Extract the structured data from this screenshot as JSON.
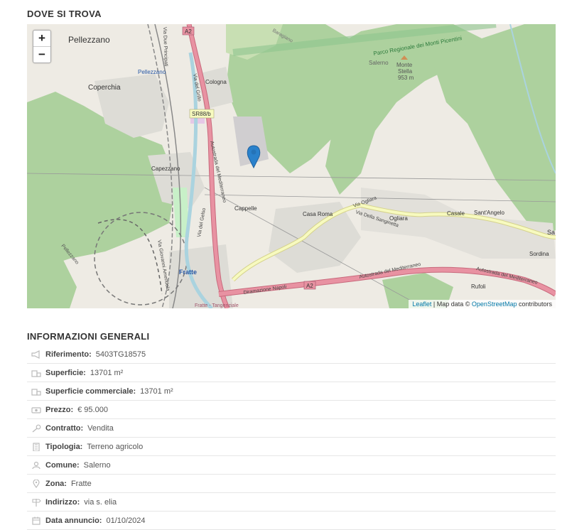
{
  "location_section": {
    "title": "DOVE SI TROVA"
  },
  "map": {
    "zoom_in_label": "+",
    "zoom_out_label": "−",
    "attribution": {
      "leaflet": "Leaflet",
      "mapdata": " | Map data © ",
      "osm": "OpenStreetMap",
      "contributors": " contributors"
    },
    "labels": {
      "pellezzano": "Pellezzano",
      "pellezzano_blue": "Pellezzano",
      "coperchia": "Coperchia",
      "cologna": "Cologna",
      "capezzano": "Capezzano",
      "cappelle": "Cappelle",
      "casa_roma": "Casa Roma",
      "ogliara": "Ogliara",
      "casale": "Casale",
      "santangelo": "Sant'Angelo",
      "sordina": "Sordina",
      "rufoli": "Rufoli",
      "fratte": "Fratte",
      "monte": "Monte",
      "stella": "Stella",
      "elev": "953 m",
      "salerno_top": "Salerno",
      "parco": "Parco Regionale dei Monti Picentini",
      "a2_top": "A2",
      "a2_bottom": "A2",
      "sr88b": "SR88/b",
      "autostrada_1": "Autostrada del Mediterraneo",
      "autostrada_2": "Autostrada del Mediterraneo",
      "autostrada_3": "Autostrada del Mediterraneo",
      "diramazione": "Diramazione Napoli",
      "via_ogliara": "Via Ogliara",
      "via_sanginetta": "Via Della Sanginetta",
      "via_grillo": "Via del Grillo",
      "via_gelso": "Via del Gelso",
      "via_principati": "Via Due Principati",
      "via_amendola": "Via Giovanni Amendola",
      "fratte_tangenziale": "Fratte - Tangenziale",
      "sa_edge": "Sa",
      "pellezzano_rot": "Pellezzano",
      "baragiano": "Baragiano"
    },
    "colors": {
      "land": "#eeebe4",
      "forest": "#add19e",
      "motorway": "#e892a2",
      "trunk": "#f9b29c",
      "secondary": "#f7fabf",
      "pin": "#2a81cb"
    }
  },
  "general_section": {
    "title": "INFORMAZIONI GENERALI",
    "rows": [
      {
        "icon": "megaphone-icon",
        "label": "Riferimento:",
        "value": "5403TG18575"
      },
      {
        "icon": "area-icon",
        "label": "Superficie:",
        "value": "13701 m²"
      },
      {
        "icon": "area-icon",
        "label": "Superficie commerciale:",
        "value": "13701 m²"
      },
      {
        "icon": "money-icon",
        "label": "Prezzo:",
        "value": "€ 95.000"
      },
      {
        "icon": "key-icon",
        "label": "Contratto:",
        "value": "Vendita"
      },
      {
        "icon": "building-icon",
        "label": "Tipologia:",
        "value": "Terreno agricolo"
      },
      {
        "icon": "city-icon",
        "label": "Comune:",
        "value": "Salerno"
      },
      {
        "icon": "location-pin-icon",
        "label": "Zona:",
        "value": "Fratte"
      },
      {
        "icon": "signpost-icon",
        "label": "Indirizzo:",
        "value": "via s. elia"
      },
      {
        "icon": "calendar-icon",
        "label": "Data annuncio:",
        "value": "01/10/2024"
      }
    ]
  }
}
